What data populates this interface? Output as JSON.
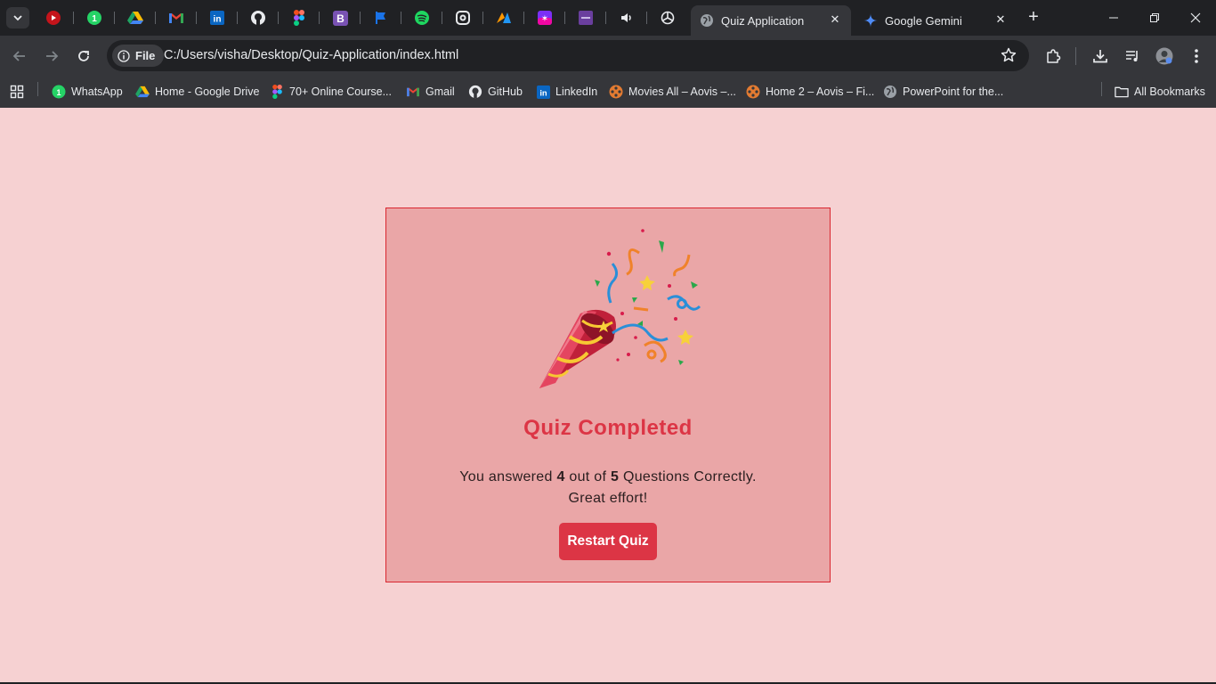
{
  "browser": {
    "tabs": [
      {
        "title": "Quiz Application",
        "active": true
      },
      {
        "title": "Google Gemini",
        "active": false
      }
    ],
    "pinned_tab_icons": [
      "youtube-icon",
      "whatsapp-icon",
      "google-drive-icon",
      "gmail-icon",
      "linkedin-icon",
      "github-icon",
      "figma-icon",
      "bootstrap-icon",
      "flag-icon",
      "spotify-icon",
      "copilot-icon",
      "app-icon",
      "star-app-icon",
      "coolors-icon",
      "speaker-icon",
      "chatgpt-icon"
    ],
    "address_chip": "File",
    "url": "C:/Users/visha/Desktop/Quiz-Application/index.html",
    "bookmarks": [
      {
        "label": "WhatsApp",
        "icon": "whatsapp-icon"
      },
      {
        "label": "Home - Google Drive",
        "icon": "google-drive-icon"
      },
      {
        "label": "70+ Online Course...",
        "icon": "figma-icon"
      },
      {
        "label": "Gmail",
        "icon": "gmail-icon"
      },
      {
        "label": "GitHub",
        "icon": "github-icon"
      },
      {
        "label": "LinkedIn",
        "icon": "linkedin-icon"
      },
      {
        "label": "Movies All – Aovis –...",
        "icon": "film-reel-icon"
      },
      {
        "label": "Home 2 – Aovis – Fi...",
        "icon": "film-reel-icon"
      },
      {
        "label": "PowerPoint for the...",
        "icon": "globe-icon"
      }
    ],
    "all_bookmarks": "All Bookmarks"
  },
  "quiz": {
    "heading": "Quiz Completed",
    "result_prefix": "You answered",
    "score": "4",
    "result_middle": "out of",
    "total": "5",
    "result_suffix": "Questions Correctly.",
    "feedback": "Great effort!",
    "restart_label": "Restart Quiz",
    "accent_color": "#dc3545",
    "background_color": "#f6d1d2",
    "card_color": "#eaa6a7"
  }
}
